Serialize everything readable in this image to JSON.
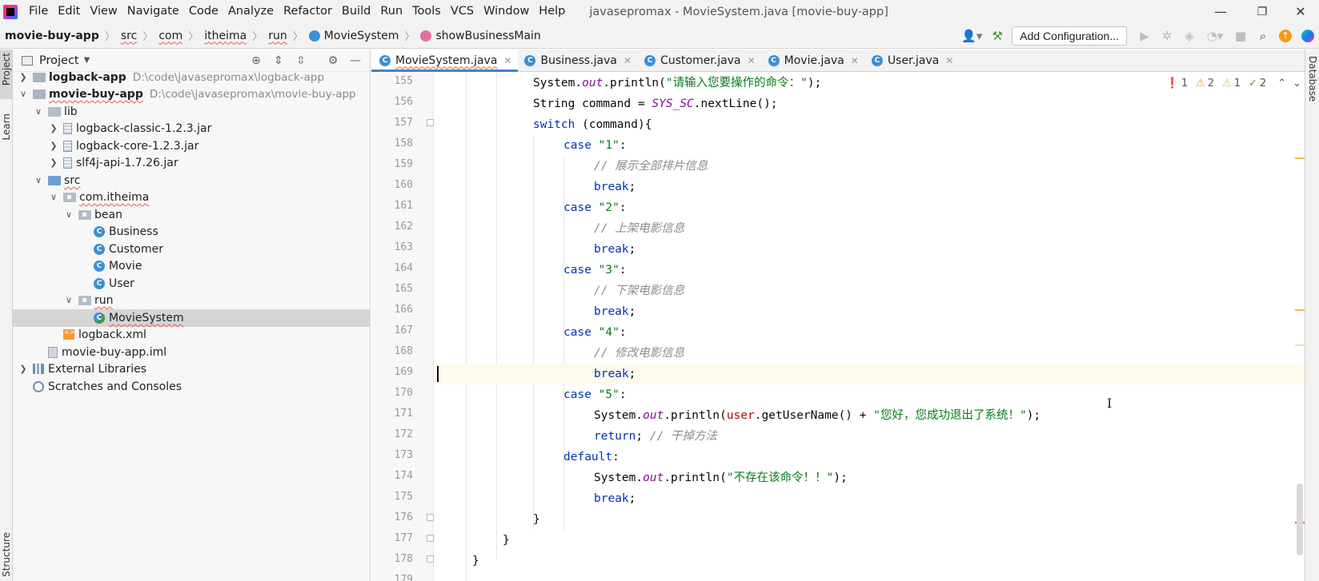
{
  "menu": {
    "items": [
      "File",
      "Edit",
      "View",
      "Navigate",
      "Code",
      "Analyze",
      "Refactor",
      "Build",
      "Run",
      "Tools",
      "VCS",
      "Window",
      "Help"
    ],
    "window_title": "javasepromax - MovieSystem.java [movie-buy-app]",
    "minimize": "—",
    "restore": "❐",
    "close": "✕"
  },
  "nav": {
    "crumbs": [
      "movie-buy-app",
      "src",
      "com",
      "itheima",
      "run",
      "MovieSystem",
      "showBusinessMain"
    ],
    "add_configuration": "Add Configuration..."
  },
  "stripes": {
    "project": "Project",
    "learn": "Learn",
    "structure": "Structure",
    "database": "Database"
  },
  "project_panel": {
    "title": "Project",
    "tree": [
      {
        "label": "logback-app",
        "hint": "D:\\code\\javasepromax\\logback-app"
      },
      {
        "label": "movie-buy-app",
        "hint": "D:\\code\\javasepromax\\movie-buy-app"
      },
      {
        "label": "lib"
      },
      {
        "label": "logback-classic-1.2.3.jar"
      },
      {
        "label": "logback-core-1.2.3.jar"
      },
      {
        "label": "slf4j-api-1.7.26.jar"
      },
      {
        "label": "src"
      },
      {
        "label": "com.itheima"
      },
      {
        "label": "bean"
      },
      {
        "label": "Business"
      },
      {
        "label": "Customer"
      },
      {
        "label": "Movie"
      },
      {
        "label": "User"
      },
      {
        "label": "run"
      },
      {
        "label": "MovieSystem"
      },
      {
        "label": "logback.xml"
      },
      {
        "label": "movie-buy-app.iml"
      },
      {
        "label": "External Libraries"
      },
      {
        "label": "Scratches and Consoles"
      }
    ]
  },
  "editor": {
    "tabs": [
      {
        "label": "MovieSystem.java"
      },
      {
        "label": "Business.java"
      },
      {
        "label": "Customer.java"
      },
      {
        "label": "Movie.java"
      },
      {
        "label": "User.java"
      }
    ],
    "inspections": {
      "errors": "1",
      "warnings": "2",
      "weak_warnings": "1",
      "typos": "2"
    },
    "line_numbers": [
      "155",
      "156",
      "157",
      "158",
      "159",
      "160",
      "161",
      "162",
      "163",
      "164",
      "165",
      "166",
      "167",
      "168",
      "169",
      "170",
      "171",
      "172",
      "173",
      "174",
      "175",
      "176",
      "177",
      "178",
      "179"
    ],
    "code": {
      "l155": {
        "a": "System.",
        "b": "out",
        "c": ".println(",
        "d": "\"请输入您要操作的命令：\"",
        "e": ");"
      },
      "l156": {
        "a": "String command = ",
        "b": "SYS_SC",
        "c": ".nextLine();"
      },
      "l157": {
        "a": "switch",
        "b": " (command){"
      },
      "l158": {
        "a": "case ",
        "b": "\"1\"",
        "c": ":"
      },
      "l159": {
        "a": "// 展示全部排片信息"
      },
      "l160": {
        "a": "break",
        "b": ";"
      },
      "l161": {
        "a": "case ",
        "b": "\"2\"",
        "c": ":"
      },
      "l162": {
        "a": "// 上架电影信息"
      },
      "l163": {
        "a": "break",
        "b": ";"
      },
      "l164": {
        "a": "case ",
        "b": "\"3\"",
        "c": ":"
      },
      "l165": {
        "a": "// 下架电影信息"
      },
      "l166": {
        "a": "break",
        "b": ";"
      },
      "l167": {
        "a": "case ",
        "b": "\"4\"",
        "c": ":"
      },
      "l168": {
        "a": "// 修改电影信息"
      },
      "l169": {
        "a": "break",
        "b": ";"
      },
      "l170": {
        "a": "case ",
        "b": "\"5\"",
        "c": ":"
      },
      "l171": {
        "a": "System.",
        "b": "out",
        "c": ".println(",
        "d": "user",
        "e": ".getUserName() + ",
        "f": "\"您好，您成功退出了系统！\"",
        "g": ");"
      },
      "l172": {
        "a": "return",
        "b": "; ",
        "c": "// 干掉方法"
      },
      "l173": {
        "a": "default",
        "b": ":"
      },
      "l174": {
        "a": "System.",
        "b": "out",
        "c": ".println(",
        "d": "\"不存在该命令！！\"",
        "e": ");"
      },
      "l175": {
        "a": "break",
        "b": ";"
      },
      "l176": {
        "a": "}"
      },
      "l177": {
        "a": "}"
      },
      "l178": {
        "a": "}"
      }
    }
  },
  "colors": {
    "keyword": "#0033b3",
    "string": "#067d17",
    "field": "#871094",
    "comment": "#8c8c8c",
    "error_var": "#c00000",
    "accent": "#4083c9"
  }
}
